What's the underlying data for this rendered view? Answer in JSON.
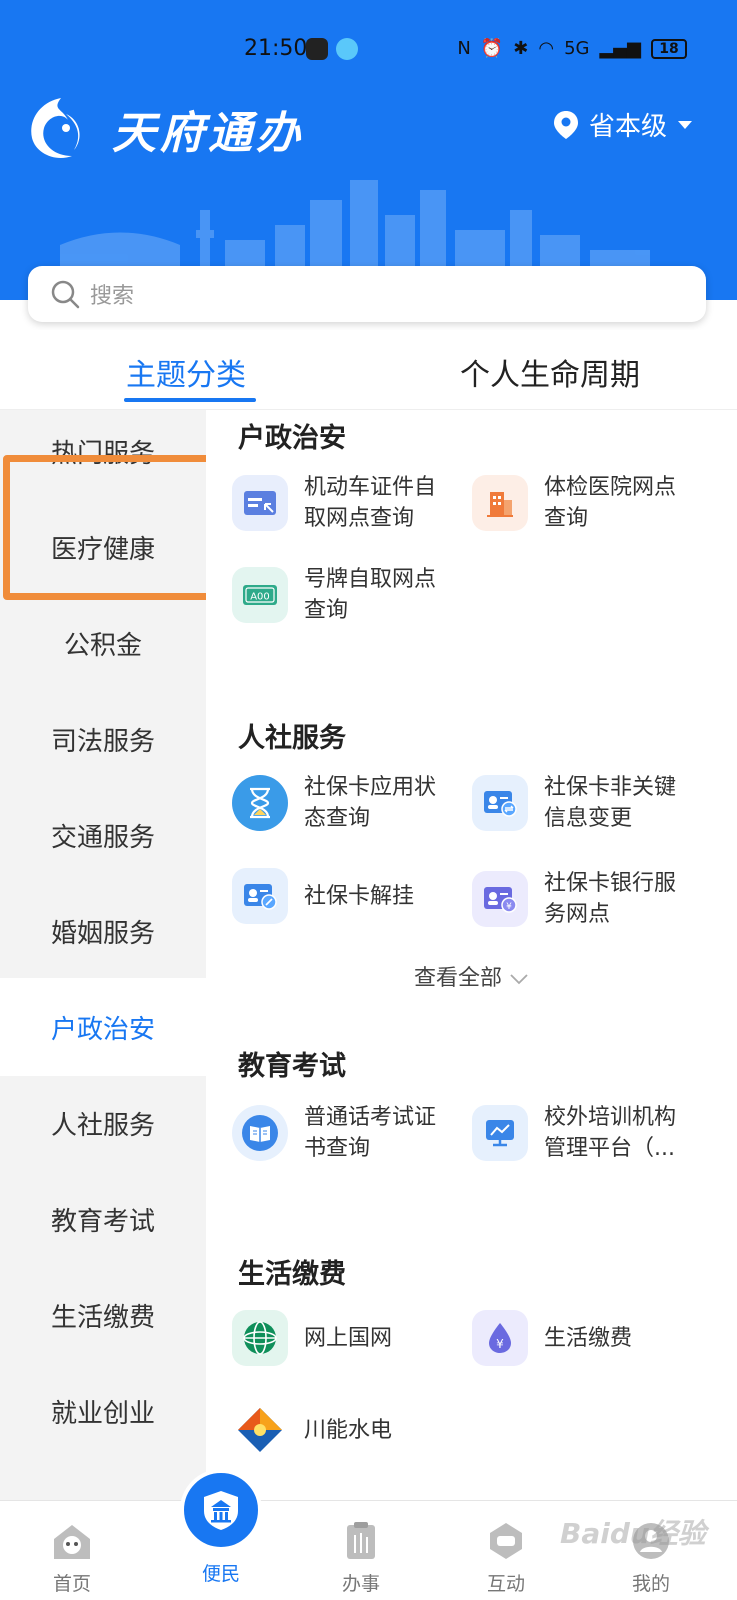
{
  "status_bar": {
    "time": "21:50",
    "network": "5G",
    "battery": "18"
  },
  "header": {
    "brand_title": "天府通办",
    "region": "省本级"
  },
  "search": {
    "placeholder": "搜索"
  },
  "tabs": [
    {
      "label": "主题分类",
      "active": true
    },
    {
      "label": "个人生命周期",
      "active": false
    }
  ],
  "sidebar": {
    "items": [
      {
        "label": "热门服务"
      },
      {
        "label": "医疗健康"
      },
      {
        "label": "公积金"
      },
      {
        "label": "司法服务"
      },
      {
        "label": "交通服务"
      },
      {
        "label": "婚姻服务"
      },
      {
        "label": "户政治安",
        "active": true
      },
      {
        "label": "人社服务"
      },
      {
        "label": "教育考试"
      },
      {
        "label": "生活缴费"
      },
      {
        "label": "就业创业"
      }
    ]
  },
  "sections": [
    {
      "title": "户政治安",
      "items": [
        {
          "line1": "机动车证件自",
          "line2": "取网点查询",
          "icon": "vehicle-license-card-icon"
        },
        {
          "line1": "体检医院网点",
          "line2": "查询",
          "icon": "hospital-building-icon"
        },
        {
          "line1": "号牌自取网点",
          "line2": "查询",
          "icon": "license-plate-icon",
          "plate_text": "A00"
        }
      ]
    },
    {
      "title": "人社服务",
      "items": [
        {
          "line1": "社保卡应用状",
          "line2": "态查询",
          "icon": "hourglass-icon"
        },
        {
          "line1": "社保卡非关键",
          "line2": "信息变更",
          "icon": "id-card-exchange-icon"
        },
        {
          "line1": "社保卡解挂",
          "line2": "",
          "icon": "id-card-edit-icon"
        },
        {
          "line1": "社保卡银行服",
          "line2": "务网点",
          "icon": "id-card-yuan-icon"
        }
      ],
      "view_all": "查看全部"
    },
    {
      "title": "教育考试",
      "items": [
        {
          "line1": "普通话考试证",
          "line2": "书查询",
          "icon": "book-icon"
        },
        {
          "line1": "校外培训机构",
          "line2": "管理平台（...",
          "icon": "training-screen-icon"
        }
      ]
    },
    {
      "title": "生活缴费",
      "items": [
        {
          "line1": "网上国网",
          "line2": "",
          "icon": "state-grid-logo-icon"
        },
        {
          "line1": "生活缴费",
          "line2": "",
          "icon": "water-drop-yuan-icon"
        },
        {
          "line1": "川能水电",
          "line2": "",
          "icon": "sichuan-energy-logo-icon"
        }
      ]
    }
  ],
  "tabbar": {
    "items": [
      {
        "label": "首页",
        "icon": "panda-home-icon"
      },
      {
        "label": "便民",
        "icon": "temple-badge-icon",
        "active": true
      },
      {
        "label": "办事",
        "icon": "clipboard-bamboo-icon"
      },
      {
        "label": "互动",
        "icon": "chat-badge-icon"
      },
      {
        "label": "我的",
        "icon": "user-avatar-icon"
      }
    ]
  },
  "watermark": "Baidu经验",
  "colors": {
    "primary": "#1877f2",
    "highlight_border": "#f08c3a",
    "sidebar_bg": "#f3f3f3"
  }
}
